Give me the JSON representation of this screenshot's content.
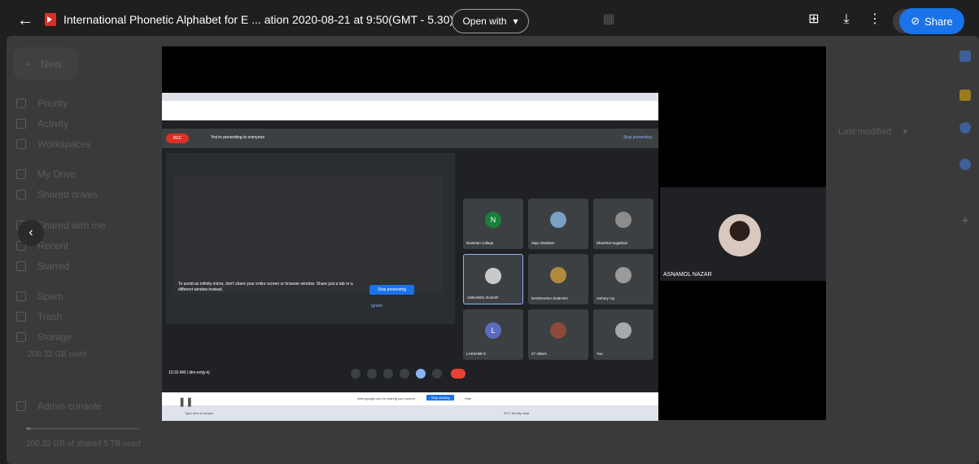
{
  "header": {
    "file_title": "International Phonetic Alphabet for E ... ation 2020-08-21 at 9:50(GMT - 5.30)",
    "open_with_label": "Open with",
    "share_label": "Share"
  },
  "sidebar": {
    "new_label": "New",
    "items": [
      "Priority",
      "Activity",
      "Workspaces",
      "My Drive",
      "Shared drives",
      "Shared with me",
      "Recent",
      "Starred",
      "Spam",
      "Trash",
      "Storage"
    ],
    "storage_used": "200.32 GB used",
    "admin_label": "Admin console",
    "storage_footer": "200.32 GB of shared 5 TB used",
    "storage_fraction": 0.04
  },
  "drive_list": {
    "sort_label": "Last modified"
  },
  "video": {
    "meet_screen": {
      "rec_label": "REC",
      "presenting_text": "You're presenting to everyone",
      "stop_presenting_top": "Stop presenting",
      "warning_text": "To avoid an infinity mirror, don't share your entire screen or browser window. Share just a tab or a different window instead.",
      "stop_presenting_button": "Stop presenting",
      "ignore_label": "Ignore",
      "clock_text": "10:32 AM  |  dim-emjy-iij",
      "tiles": [
        {
          "name": "Newman college",
          "initial": "N",
          "color": "#188038"
        },
        {
          "name": "Saju Abraham",
          "initial": "",
          "color": "#7aa0c4"
        },
        {
          "name": "Sheethal Sugathan",
          "initial": "",
          "color": "#8c8c8c"
        },
        {
          "name": "ASNAMOL NAZAR",
          "initial": "",
          "color": "#c9c9c9"
        },
        {
          "name": "NANDHANA SUBASH",
          "initial": "",
          "color": "#b08a3c"
        },
        {
          "name": "reshmy roy",
          "initial": "",
          "color": "#9a9a9a"
        },
        {
          "name": "LAKSHMI S",
          "initial": "L",
          "color": "#5c6bc0"
        },
        {
          "name": "27 others",
          "initial": "",
          "color": "#8d4a3a"
        },
        {
          "name": "You",
          "initial": "",
          "color": "#a7a9ab"
        }
      ],
      "share_notice": "meet.google.com is sharing your screen.",
      "share_notice_stop": "Stop sharing",
      "share_notice_hide": "Hide",
      "taskbar_search": "Type here to search",
      "weather": "30°C Mostly clear"
    },
    "camera_tile_name": "ASNAMOL NAZAR"
  }
}
